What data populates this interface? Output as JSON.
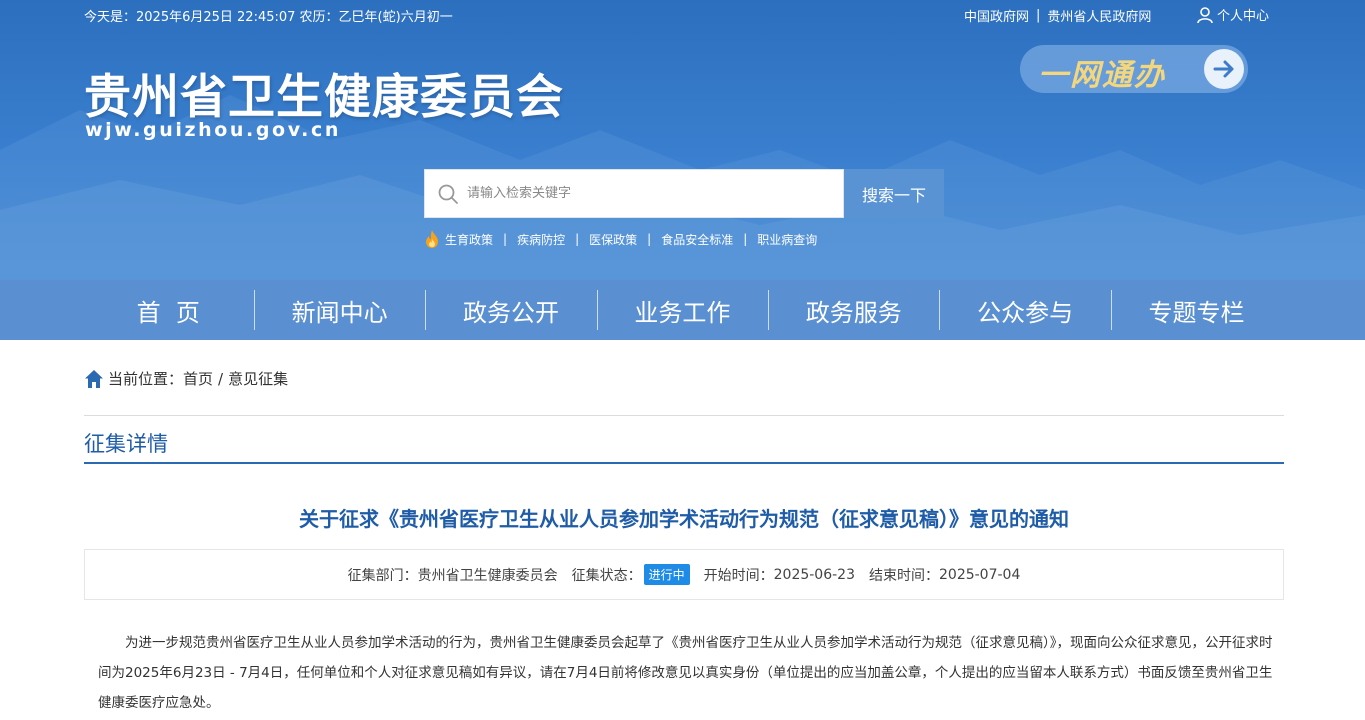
{
  "topbar": {
    "date": "今天是：2025年6月25日  22:45:07  农历：乙巳年(蛇)六月初一",
    "links": [
      "中国政府网",
      "贵州省人民政府网"
    ],
    "separator": "|",
    "user_center": "个人中心"
  },
  "logo": {
    "title": "贵州省卫生健康委员会",
    "url": "wjw.guizhou.gov.cn"
  },
  "ywtb": {
    "label": "一网通办"
  },
  "search": {
    "placeholder": "请输入检索关键字",
    "button": "搜索一下"
  },
  "hot_links": [
    "生育政策",
    "疾病防控",
    "医保政策",
    "食品安全标准",
    "职业病查询"
  ],
  "nav": [
    "首  页",
    "新闻中心",
    "政务公开",
    "业务工作",
    "政务服务",
    "公众参与",
    "专题专栏"
  ],
  "breadcrumb": {
    "prefix": "当前位置：",
    "home": "首页",
    "sep": "/",
    "current": "意见征集"
  },
  "section_title": "征集详情",
  "article": {
    "title": "关于征求《贵州省医疗卫生从业人员参加学术活动行为规范（征求意见稿）》意见的通知",
    "meta": {
      "dept_label": "征集部门：",
      "dept": "贵州省卫生健康委员会",
      "status_label": "征集状态：",
      "status": "进行中",
      "start_label": "开始时间：",
      "start": "2025-06-23",
      "end_label": "结束时间：",
      "end": "2025-07-04"
    },
    "body": "为进一步规范贵州省医疗卫生从业人员参加学术活动的行为，贵州省卫生健康委员会起草了《贵州省医疗卫生从业人员参加学术活动行为规范（征求意见稿）》，现面向公众征求意见，公开征求时间为2025年6月23日 - 7月4日，任何单位和个人对征求意见稿如有异议，请在7月4日前将修改意见以真实身份（单位提出的应当加盖公章，个人提出的应当留本人联系方式）书面反馈至贵州省卫生健康委医疗应急处。"
  },
  "colors": {
    "header_blue": "#3a7fcf",
    "nav_blue": "#5a8fd1",
    "title_blue": "#1f5ca8",
    "badge_blue": "#1e8be6",
    "ywtb_gold": "#f3d77f"
  }
}
